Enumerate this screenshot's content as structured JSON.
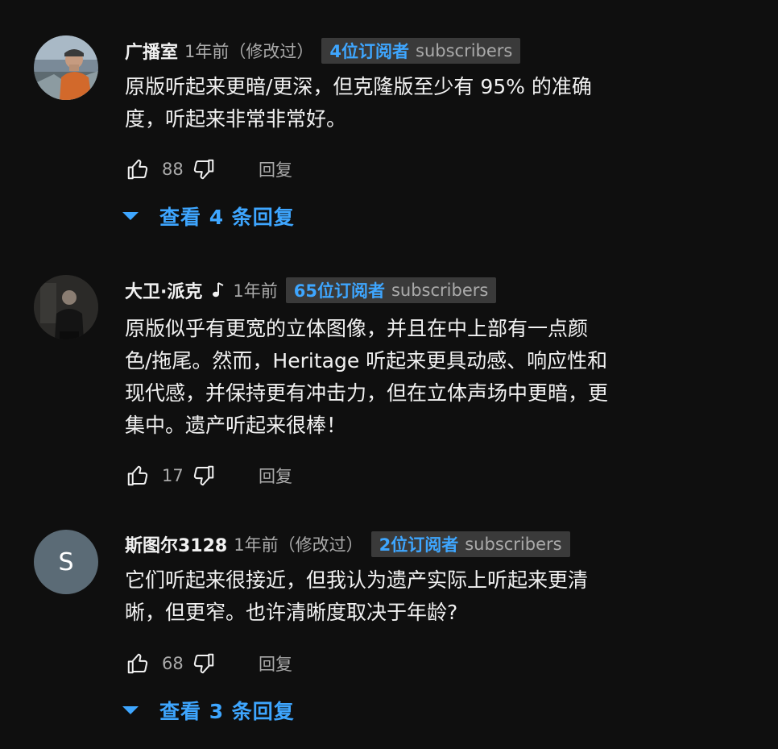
{
  "comments": [
    {
      "author": "广播室",
      "has_music_icon": false,
      "time": "1年前（修改过）",
      "badge_count": "4位订阅者",
      "badge_unit": "subscribers",
      "text": "原版听起来更暗/更深，但克隆版至少有 95% 的准确\n度，听起来非常非常好。",
      "likes": "88",
      "reply_label": "回复",
      "view_replies": "查看 4 条回复",
      "avatar_icon": "user-photo-avatar"
    },
    {
      "author": "大卫·派克",
      "has_music_icon": true,
      "time": "1年前",
      "badge_count": "65位订阅者",
      "badge_unit": "subscribers",
      "text": "原版似乎有更宽的立体图像，并且在中上部有一点颜\n色/拖尾。然而，Heritage 听起来更具动感、响应性和\n现代感，并保持更有冲击力，但在立体声场中更暗，更\n集中。遗产听起来很棒！",
      "likes": "17",
      "reply_label": "回复",
      "view_replies": "",
      "avatar_icon": "user-photo-avatar"
    },
    {
      "author": "斯图尔3128",
      "has_music_icon": false,
      "time": "1年前（修改过）",
      "badge_count": "2位订阅者",
      "badge_unit": "subscribers",
      "text": "它们听起来很接近，但我认为遗产实际上听起来更清\n晰，但更窄。也许清晰度取决于年龄?",
      "likes": "68",
      "reply_label": "回复",
      "view_replies": "查看 3 条回复",
      "avatar_letter": "S"
    }
  ],
  "colors": {
    "background": "#0f0f0f",
    "text": "#f1f1f1",
    "secondary": "#aaaaaa",
    "accent": "#3ea6ff",
    "badge_bg": "#3a3a3a"
  }
}
